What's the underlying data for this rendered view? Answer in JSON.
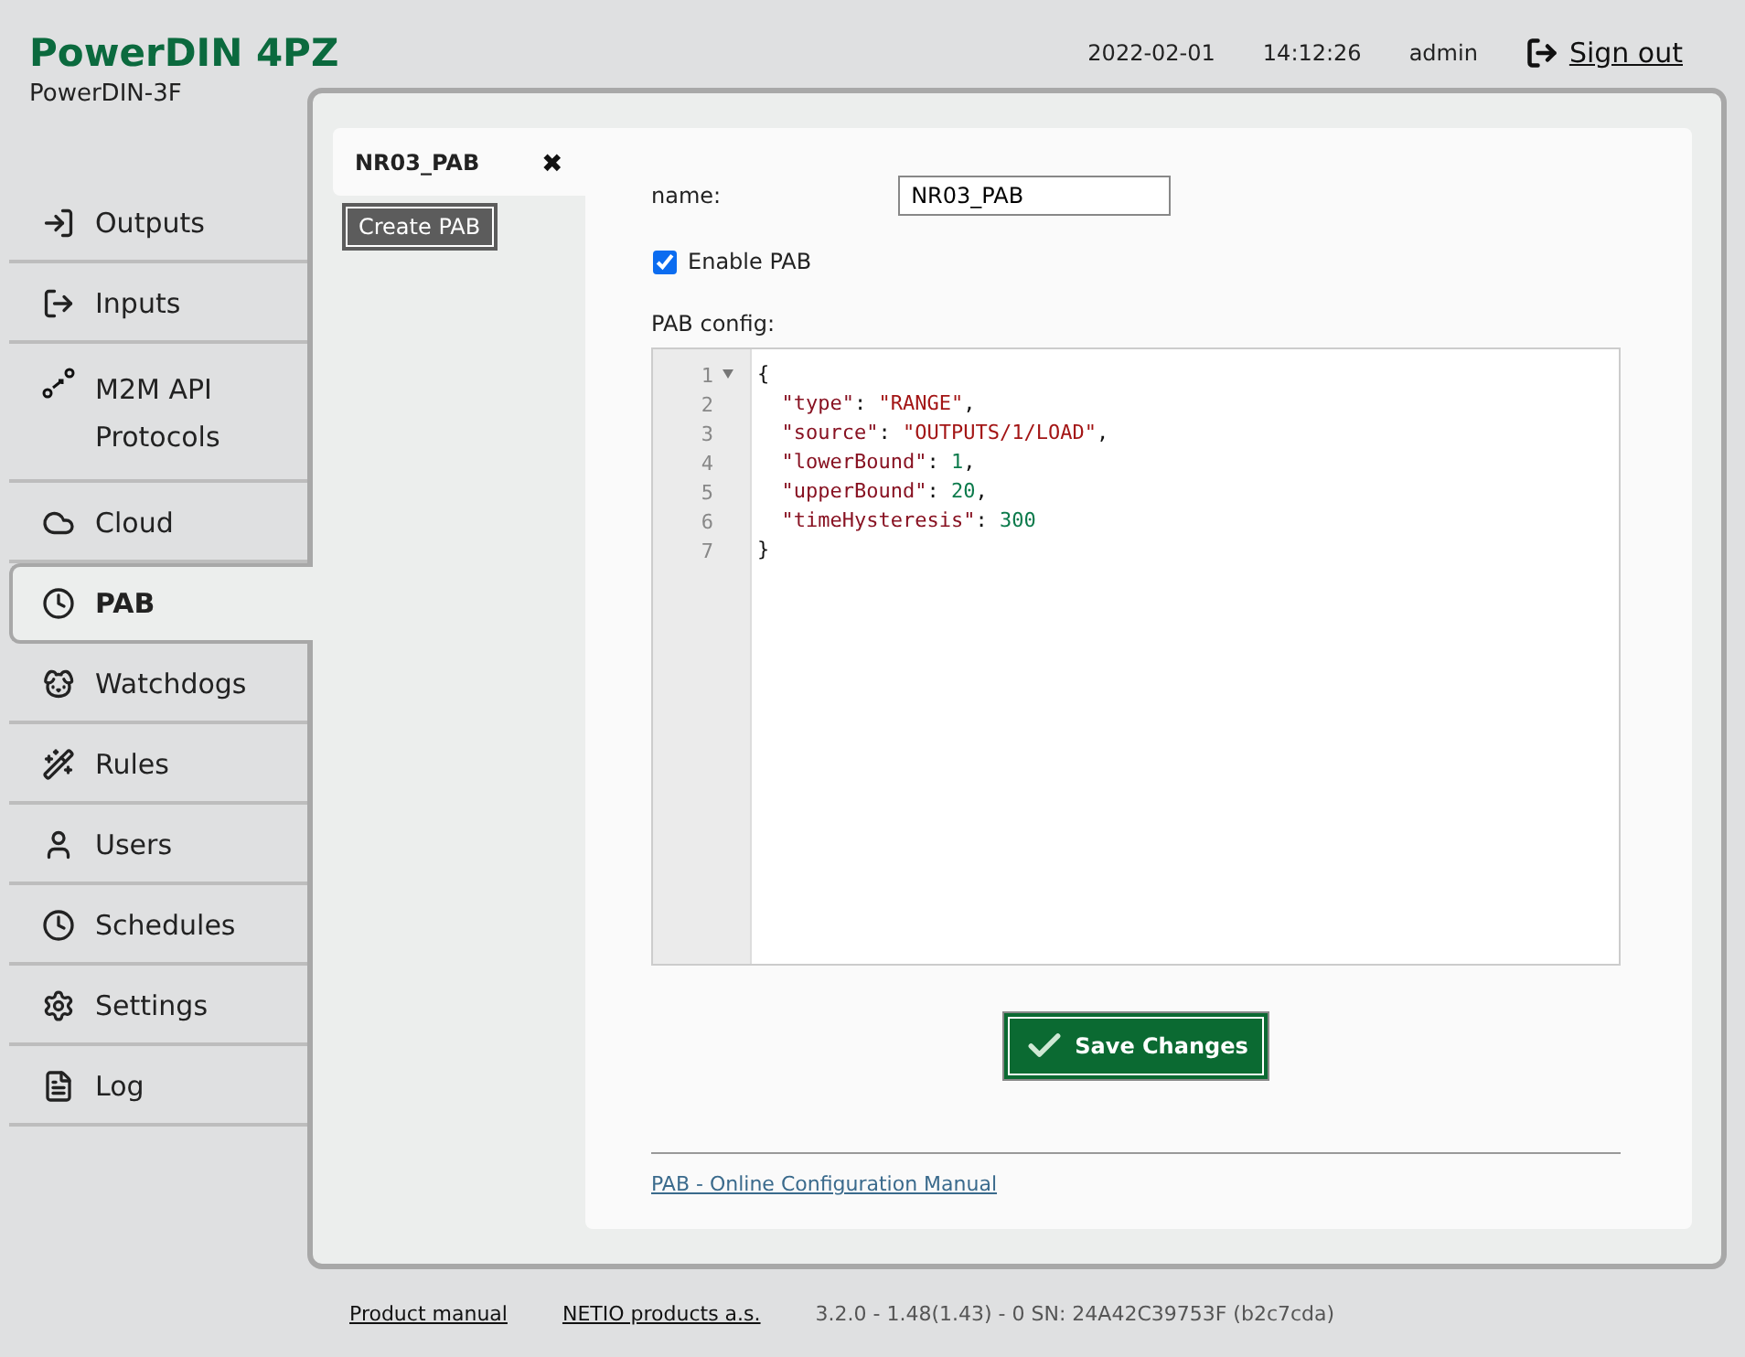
{
  "header": {
    "title": "PowerDIN 4PZ",
    "subtitle": "PowerDIN-3F",
    "date": "2022-02-01",
    "time": "14:12:26",
    "user": "admin",
    "sign_out": "Sign out"
  },
  "sidebar": {
    "items": [
      {
        "label": "Outputs",
        "selected": false
      },
      {
        "label": "Inputs",
        "selected": false
      },
      {
        "label": "M2M API Protocols",
        "selected": false
      },
      {
        "label": "Cloud",
        "selected": false
      },
      {
        "label": "PAB",
        "selected": true
      },
      {
        "label": "Watchdogs",
        "selected": false
      },
      {
        "label": "Rules",
        "selected": false
      },
      {
        "label": "Users",
        "selected": false
      },
      {
        "label": "Schedules",
        "selected": false
      },
      {
        "label": "Settings",
        "selected": false
      },
      {
        "label": "Log",
        "selected": false
      }
    ]
  },
  "pab_list": {
    "items": [
      {
        "label": "NR03_PAB",
        "selected": true,
        "remove": "✖"
      }
    ],
    "create_button": "Create PAB"
  },
  "form": {
    "name_label": "name:",
    "name_value": "NR03_PAB",
    "enable": {
      "label": "Enable PAB",
      "checked": true
    },
    "config_label": "PAB config:",
    "code_lines": [
      {
        "number": "1",
        "foldable": true,
        "tokens": [
          {
            "kind": "punct",
            "text": "{"
          }
        ]
      },
      {
        "number": "2",
        "foldable": false,
        "tokens": [
          {
            "kind": "key",
            "text": "  \"type\""
          },
          {
            "kind": "punct",
            "text": ": "
          },
          {
            "kind": "string",
            "text": "\"RANGE\""
          },
          {
            "kind": "punct",
            "text": ","
          }
        ]
      },
      {
        "number": "3",
        "foldable": false,
        "tokens": [
          {
            "kind": "key",
            "text": "  \"source\""
          },
          {
            "kind": "punct",
            "text": ": "
          },
          {
            "kind": "string",
            "text": "\"OUTPUTS/1/LOAD\""
          },
          {
            "kind": "punct",
            "text": ","
          }
        ]
      },
      {
        "number": "4",
        "foldable": false,
        "tokens": [
          {
            "kind": "key",
            "text": "  \"lowerBound\""
          },
          {
            "kind": "punct",
            "text": ": "
          },
          {
            "kind": "number",
            "text": "1"
          },
          {
            "kind": "punct",
            "text": ","
          }
        ]
      },
      {
        "number": "5",
        "foldable": false,
        "tokens": [
          {
            "kind": "key",
            "text": "  \"upperBound\""
          },
          {
            "kind": "punct",
            "text": ": "
          },
          {
            "kind": "number",
            "text": "20"
          },
          {
            "kind": "punct",
            "text": ","
          }
        ]
      },
      {
        "number": "6",
        "foldable": false,
        "tokens": [
          {
            "kind": "key",
            "text": "  \"timeHysteresis\""
          },
          {
            "kind": "punct",
            "text": ": "
          },
          {
            "kind": "number",
            "text": "300"
          }
        ]
      },
      {
        "number": "7",
        "foldable": false,
        "tokens": [
          {
            "kind": "punct",
            "text": "}"
          }
        ]
      }
    ],
    "save_button": "Save Changes",
    "manual_link": "PAB - Online Configuration Manual"
  },
  "footer": {
    "product_manual": "Product manual",
    "company": "NETIO products a.s.",
    "version": "3.2.0 - 1.48(1.43) - 0 SN: 24A42C39753F (b2c7cda)"
  }
}
